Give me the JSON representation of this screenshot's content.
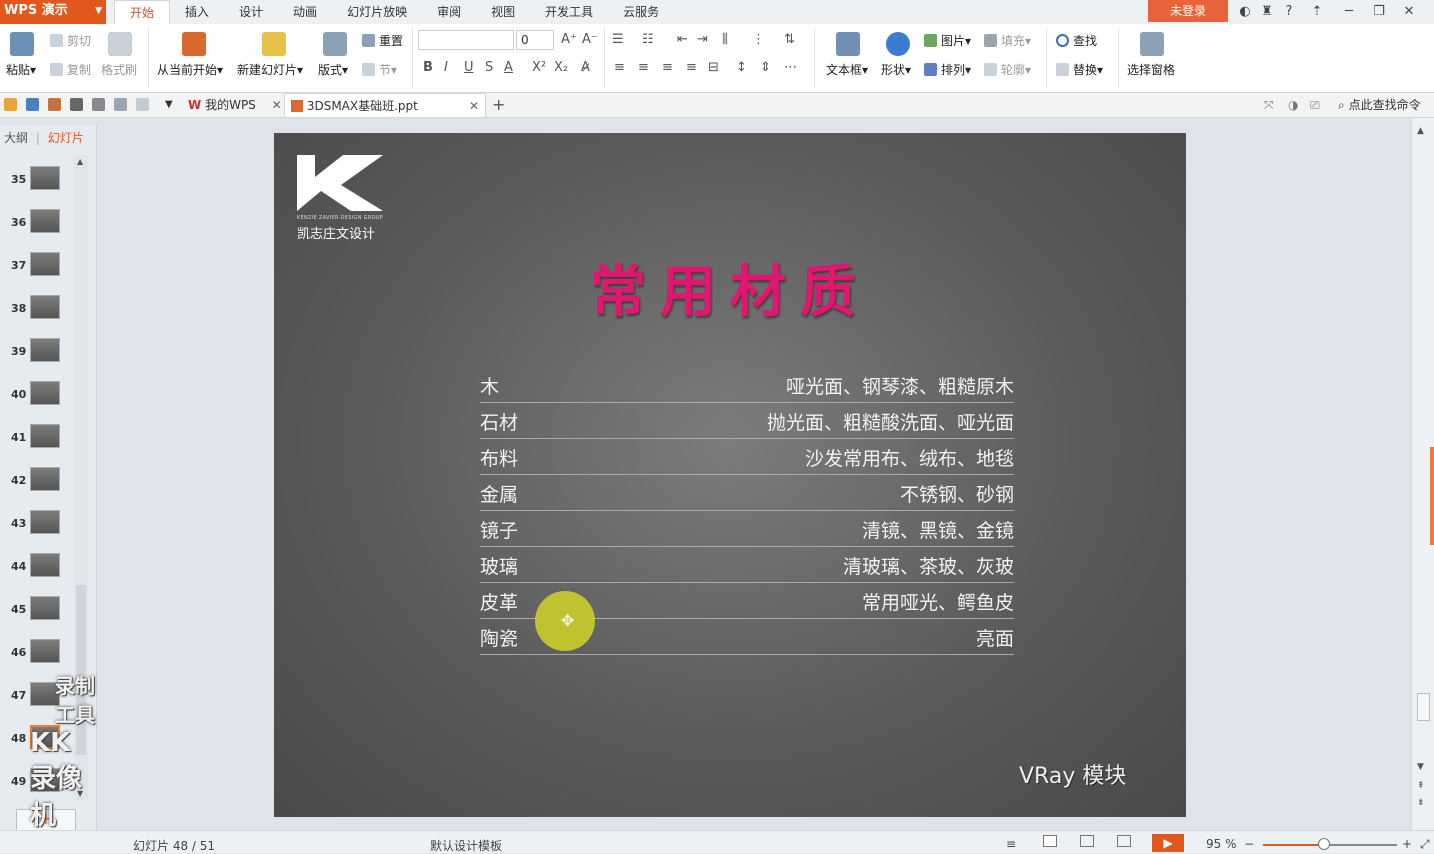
{
  "app": {
    "name": "WPS 演示"
  },
  "ribbon_tabs": [
    "开始",
    "插入",
    "设计",
    "动画",
    "幻灯片放映",
    "审阅",
    "视图",
    "开发工具",
    "云服务"
  ],
  "window": {
    "login": "未登录",
    "help": "?"
  },
  "ribbon": {
    "paste": "粘贴",
    "cut": "剪切",
    "copy": "复制",
    "format_painter": "格式刷",
    "from_current": "从当前开始",
    "new_slide": "新建幻灯片",
    "layout": "版式",
    "reset": "重置",
    "section": "节",
    "font_size": "0",
    "text_box": "文本框",
    "shape": "形状",
    "picture": "图片",
    "fill": "填充",
    "arrange": "排列",
    "outline": "轮廓",
    "find": "查找",
    "replace": "替换",
    "selection_pane": "选择窗格"
  },
  "docbar": {
    "my_wps": "我的WPS",
    "file": "3DSMAX基础班.ppt",
    "search_cmd": "点此查找命令"
  },
  "left_panel": {
    "tab_outline": "大纲",
    "tab_slides": "幻灯片",
    "thumbnails": [
      "35",
      "36",
      "37",
      "38",
      "39",
      "40",
      "41",
      "42",
      "43",
      "44",
      "45",
      "46",
      "47",
      "48",
      "49"
    ],
    "selected": "48"
  },
  "watermark": {
    "line1": "录制工具",
    "line2": "KK录像机"
  },
  "slide": {
    "logo_sub": "KENZIE ZAVIER DESIGN GROUP",
    "logo_cn": "凯志庄文设计",
    "title": "常用材质",
    "materials": [
      {
        "name": "木",
        "desc": "哑光面、钢琴漆、粗糙原木"
      },
      {
        "name": "石材",
        "desc": "抛光面、粗糙酸洗面、哑光面"
      },
      {
        "name": "布料",
        "desc": "沙发常用布、绒布、地毯"
      },
      {
        "name": "金属",
        "desc": "不锈钢、砂钢"
      },
      {
        "name": "镜子",
        "desc": "清镜、黑镜、金镜"
      },
      {
        "name": "玻璃",
        "desc": "清玻璃、茶玻、灰玻"
      },
      {
        "name": "皮革",
        "desc": "常用哑光、鳄鱼皮"
      },
      {
        "name": "陶瓷",
        "desc": "亮面"
      }
    ],
    "footer": "VRay 模块"
  },
  "status": {
    "slide_info": "幻灯片 48 / 51",
    "template": "默认设计模板",
    "zoom": "95 %",
    "zoom_level": 0.45
  },
  "colors": {
    "accent": "#e2571c",
    "title_pink": "#e0166f",
    "highlight_yellow": "#c8cc2b"
  }
}
